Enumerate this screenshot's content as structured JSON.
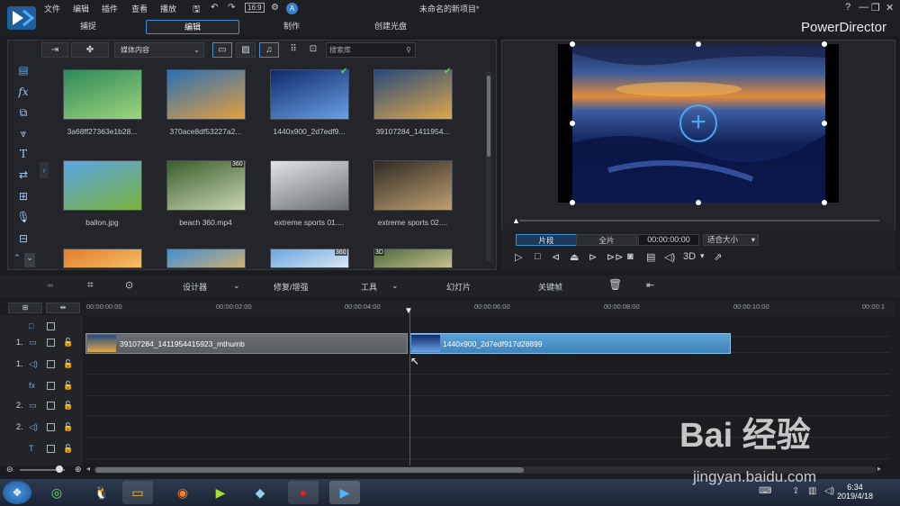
{
  "app": {
    "menu": [
      "文件",
      "编辑",
      "插件",
      "查看",
      "播放"
    ],
    "title": "未命名的新项目*",
    "brand": "PowerDirector",
    "modes": [
      "捕捉",
      "编辑",
      "制作",
      "创建光盘"
    ],
    "win_buttons": [
      "?",
      "—",
      "❐",
      "✕"
    ]
  },
  "library": {
    "dropdown": "媒体内容",
    "search_placeholder": "搜索库",
    "items": [
      {
        "name": "3a68ff27363e1b28...",
        "colors": [
          "#2c8a5a",
          "#9fd47c"
        ]
      },
      {
        "name": "370ace8df53227a2...",
        "colors": [
          "#2b6fb3",
          "#e2a040"
        ]
      },
      {
        "name": "1440x900_2d7edf9...",
        "colors": [
          "#0e2a6b",
          "#6aa0e6"
        ],
        "checked": true
      },
      {
        "name": "39107284_1411954...",
        "colors": [
          "#274a7a",
          "#e0a74b"
        ],
        "checked": true
      },
      {
        "name": "ballon.jpg",
        "colors": [
          "#5aa6e6",
          "#7bb23c"
        ]
      },
      {
        "name": "beach 360.mp4",
        "colors": [
          "#3b5e2b",
          "#c8d6b0"
        ],
        "badge": "360"
      },
      {
        "name": "extreme sports 01....",
        "colors": [
          "#dfe4e8",
          "#6a6d70"
        ]
      },
      {
        "name": "extreme sports 02....",
        "colors": [
          "#2e2a24",
          "#c0a070"
        ]
      },
      {
        "name": "",
        "colors": [
          "#e37b2a",
          "#f3c06a"
        ]
      },
      {
        "name": "",
        "colors": [
          "#3f8fd6",
          "#d0b070"
        ]
      },
      {
        "name": "",
        "colors": [
          "#6aa7e0",
          "#d9e6f2"
        ],
        "badge": "360"
      },
      {
        "name": "",
        "colors": [
          "#4c6a3a",
          "#c8c090"
        ],
        "badge": "3D"
      }
    ]
  },
  "preview": {
    "tab_clip": "片段",
    "tab_full": "全片",
    "timecode": "00:00:00:00",
    "fit": "适合大小",
    "ctrl_3d": "3D"
  },
  "toolbar": {
    "designer": "设计器",
    "fix": "修复/增强",
    "tools": "工具",
    "slideshow": "幻灯片",
    "keyframe": "关键帧"
  },
  "timeline": {
    "ruler": [
      "00:00:00:00",
      "00:00:02:00",
      "00:00:04:00",
      "00:00:06:00",
      "00:00:08:00",
      "00:00:10:00",
      "00:00:1"
    ],
    "tracks": [
      {
        "num": "",
        "icon": "□"
      },
      {
        "num": "1.",
        "icon": "▭"
      },
      {
        "num": "1.",
        "icon": "◁)"
      },
      {
        "num": "",
        "icon": "fx"
      },
      {
        "num": "2.",
        "icon": "▭"
      },
      {
        "num": "2.",
        "icon": "◁)"
      },
      {
        "num": "",
        "icon": "T"
      }
    ],
    "clip1": "39107284_1411954415923_mthumb",
    "clip2": "1440x900_2d7edf917d28899"
  },
  "taskbar": {
    "time": "6:34",
    "date": "2019/4/18"
  },
  "watermark": {
    "line1": "Bai  经验",
    "line2": "jingyan.baidu.com"
  }
}
